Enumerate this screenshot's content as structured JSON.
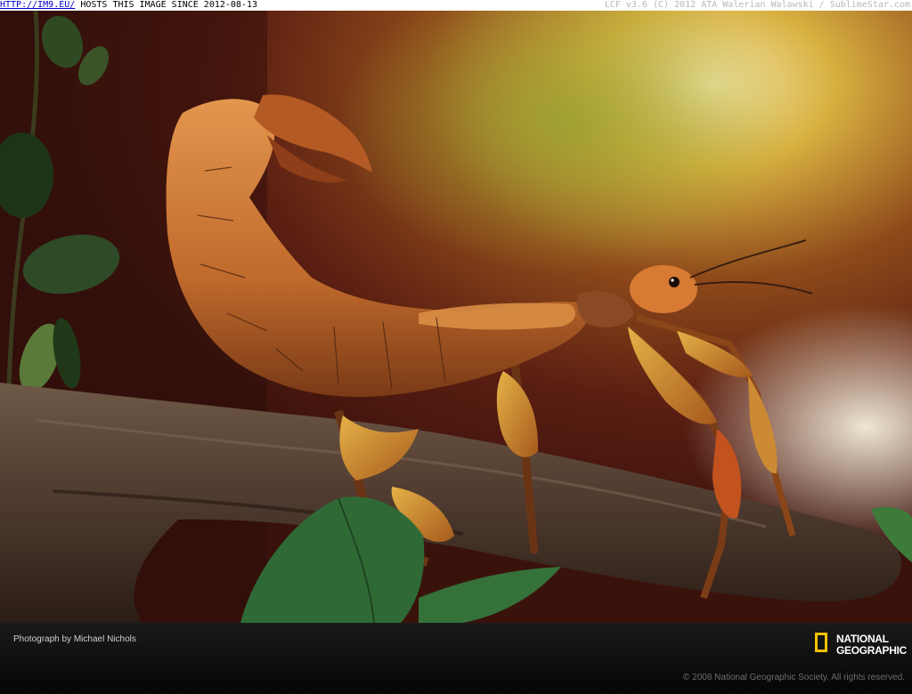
{
  "topbar": {
    "link": "HTTP://IM9.EU/",
    "notice": "HOSTS THIS IMAGE SINCE 2012-08-13",
    "right": "LCF v3.6 (C) 2012 ATA Walerian Walawski / SublimeStar.com"
  },
  "footer": {
    "credit": "Photograph by Michael Nichols",
    "logo_line1": "NATIONAL",
    "logo_line2": "GEOGRAPHIC",
    "copyright": "© 2008 National Geographic Society. All rights reserved."
  },
  "colors": {
    "logo_yellow": "#f2c200",
    "insect_orange": "#c8702e",
    "branch_brown": "#5a4436"
  }
}
